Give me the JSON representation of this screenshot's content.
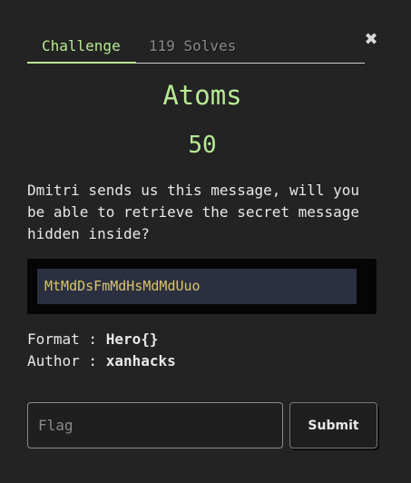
{
  "tabs": {
    "challenge_label": "Challenge",
    "solves_label": "119 Solves"
  },
  "close_icon": "close-icon",
  "challenge": {
    "name": "Atoms",
    "points": "50",
    "description": "Dmitri sends us this message, will you\nbe able to retrieve the secret message\nhidden inside?",
    "code": "MtMdDsFmMdHsMdMdUuo",
    "format_label": "Format : ",
    "format_value": "Hero{}",
    "author_label": "Author : ",
    "author_value": "xanhacks"
  },
  "form": {
    "flag_placeholder": "Flag",
    "flag_value": "",
    "submit_label": "Submit"
  },
  "colors": {
    "background": "#232323",
    "accent": "#b8e994",
    "code_text": "#d9c46b",
    "code_bg": "#2b3040"
  }
}
